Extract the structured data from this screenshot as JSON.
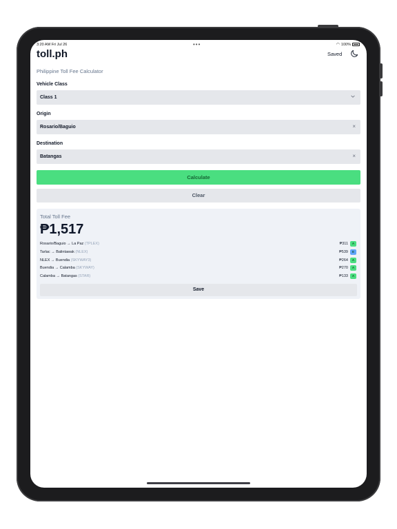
{
  "status_bar": {
    "time": "3:20 AM  Fri Jul 26",
    "dots": "•••",
    "battery": "100%"
  },
  "header": {
    "title": "toll.ph",
    "saved_label": "Saved"
  },
  "subtitle": "Philippine Toll Fee Calculator",
  "form": {
    "vehicle_label": "Vehicle Class",
    "vehicle_value": "Class 1",
    "origin_label": "Origin",
    "origin_value": "Rosario/Baguio",
    "destination_label": "Destination",
    "destination_value": "Batangas",
    "clear_glyph": "×",
    "calculate_label": "Calculate",
    "clear_label": "Clear"
  },
  "result": {
    "label": "Total Toll Fee",
    "total": "₱1,517",
    "segments": [
      {
        "route": "Rosario/Baguio → La Paz",
        "network": "(TPLEX)",
        "fee": "₱311",
        "badge": "A",
        "badge_color": "#4ade80"
      },
      {
        "route": "Tarlac → Balintawak",
        "network": "(NLEX)",
        "fee": "₱539",
        "badge": "E",
        "badge_color": "#60a5fa"
      },
      {
        "route": "NLEX → Buendia",
        "network": "(SKYWAY3)",
        "fee": "₱264",
        "badge": "A",
        "badge_color": "#4ade80"
      },
      {
        "route": "Buendia → Calamba",
        "network": "(SKYWAY)",
        "fee": "₱270",
        "badge": "A",
        "badge_color": "#4ade80"
      },
      {
        "route": "Calamba → Batangas",
        "network": "(STAR)",
        "fee": "₱133",
        "badge": "A",
        "badge_color": "#4ade80"
      }
    ],
    "save_label": "Save"
  },
  "colors": {
    "accent_green": "#4ade80",
    "field_bg": "#e5e7eb",
    "result_bg": "#eff2f7"
  }
}
